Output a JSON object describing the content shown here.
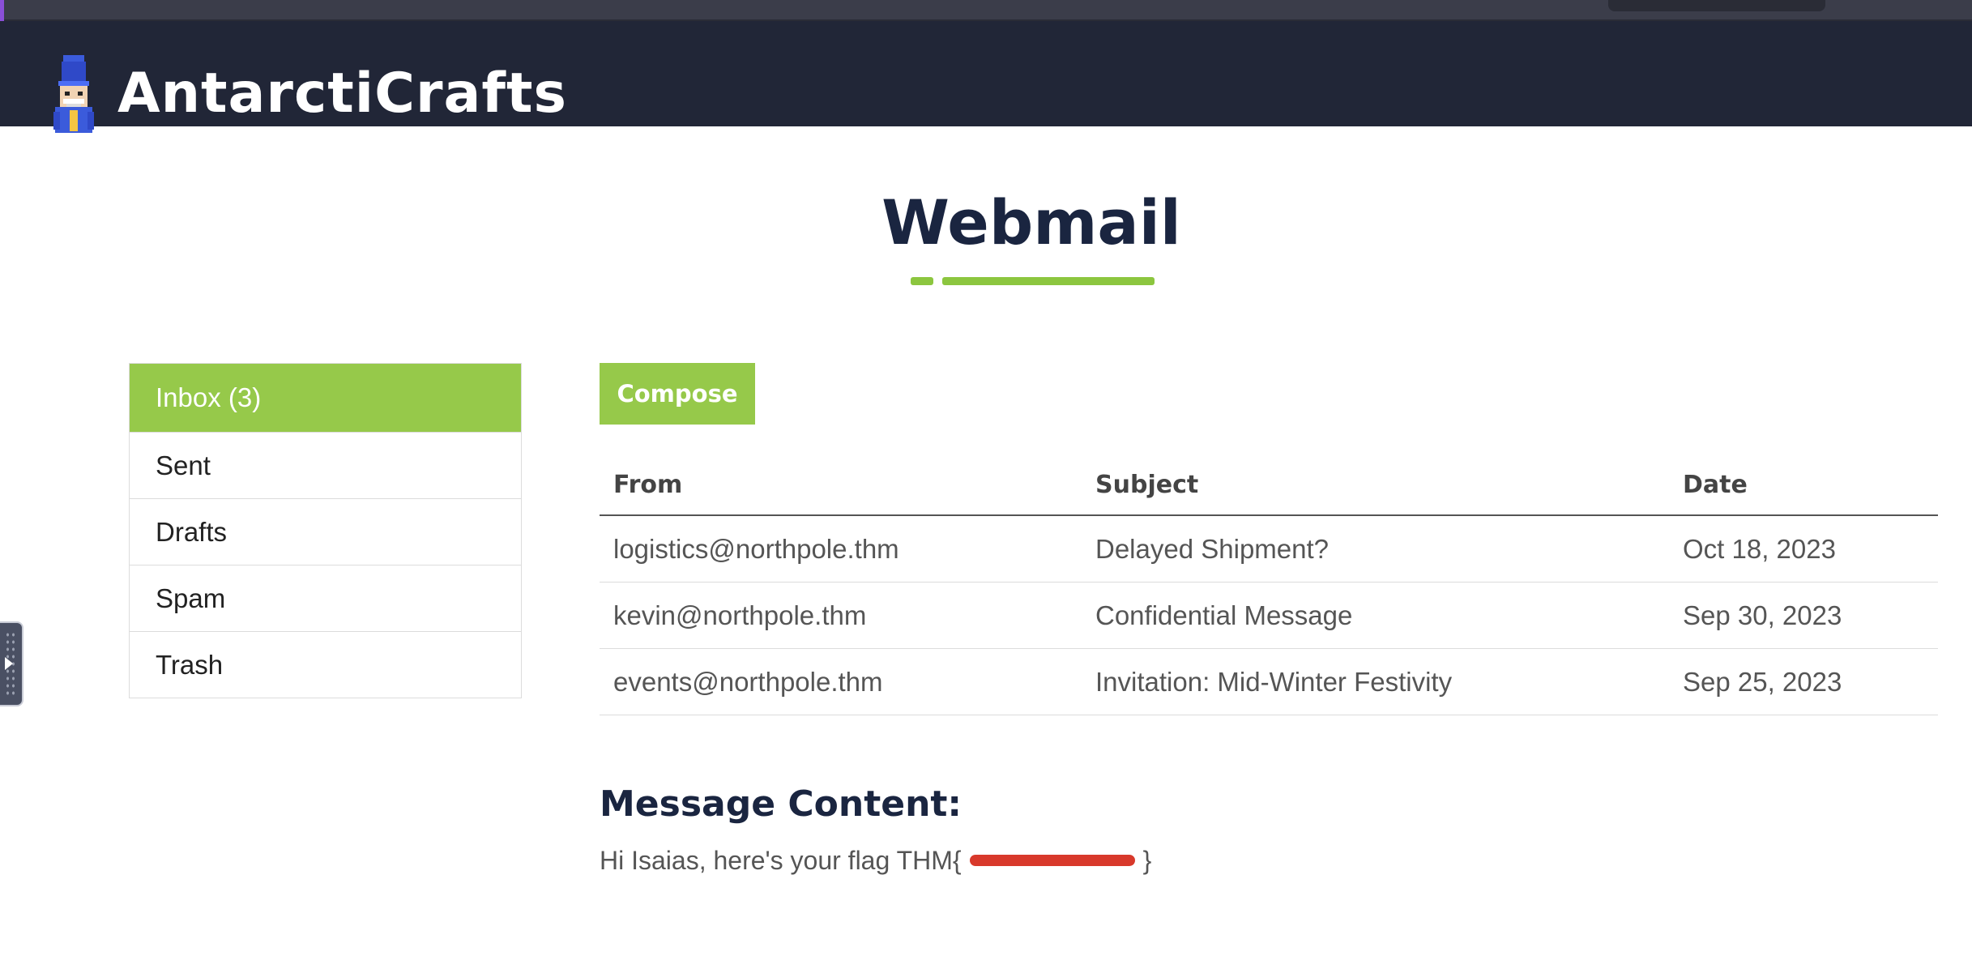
{
  "app": {
    "brand": "AntarctiCrafts",
    "page_title": "Webmail"
  },
  "sidebar": {
    "items": [
      {
        "label": "Inbox (3)",
        "active": true
      },
      {
        "label": "Sent",
        "active": false
      },
      {
        "label": "Drafts",
        "active": false
      },
      {
        "label": "Spam",
        "active": false
      },
      {
        "label": "Trash",
        "active": false
      }
    ]
  },
  "toolbar": {
    "compose_label": "Compose"
  },
  "mail_table": {
    "headers": {
      "from": "From",
      "subject": "Subject",
      "date": "Date"
    },
    "rows": [
      {
        "from": "logistics@northpole.thm",
        "subject": "Delayed Shipment?",
        "date": "Oct 18, 2023"
      },
      {
        "from": "kevin@northpole.thm",
        "subject": "Confidential Message",
        "date": "Sep 30, 2023"
      },
      {
        "from": "events@northpole.thm",
        "subject": "Invitation: Mid-Winter Festivity",
        "date": "Sep 25, 2023"
      }
    ]
  },
  "message": {
    "title": "Message Content:",
    "body_prefix": "Hi Isaias, here's your flag THM{",
    "body_suffix": "}"
  },
  "colors": {
    "accent": "#96c94a",
    "header_bg": "#212637",
    "title_color": "#1a2540",
    "redaction": "#d8392b"
  },
  "icons": {
    "logo": "nutcracker-mascot-icon",
    "side_handle": "play-icon"
  }
}
